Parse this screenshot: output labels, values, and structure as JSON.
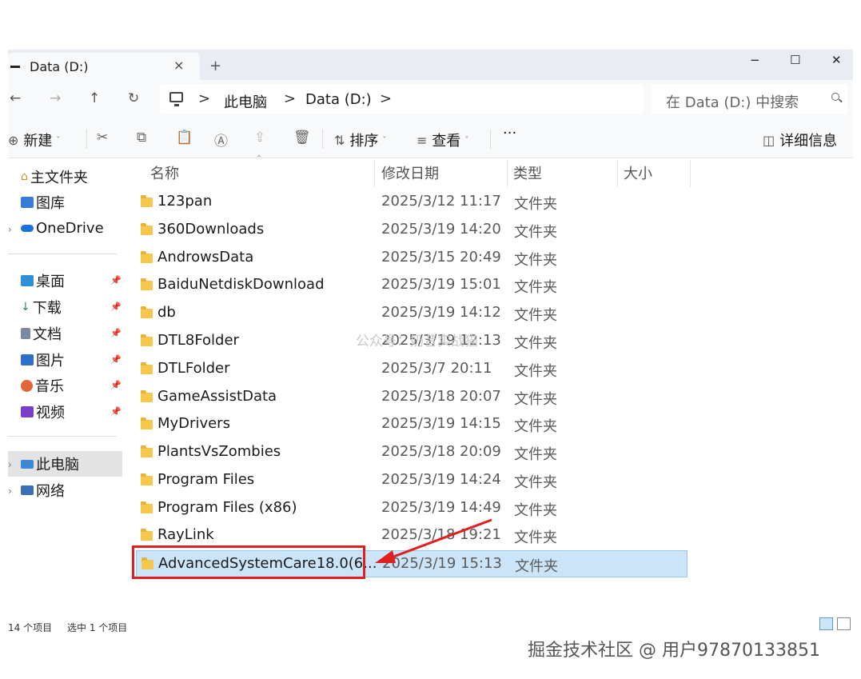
{
  "tab": {
    "title": "Data (D:)",
    "close": "×",
    "add": "+"
  },
  "window_controls": {
    "minimize": "−",
    "maximize": "☐",
    "close": "✕"
  },
  "nav": {
    "back": "←",
    "forward": "→",
    "up": "↑",
    "refresh": "↻"
  },
  "breadcrumb": {
    "sep1": ">",
    "item1": "此电脑",
    "sep2": ">",
    "item2": "Data (D:)",
    "sep3": ">"
  },
  "search": {
    "placeholder": "在 Data (D:) 中搜索"
  },
  "commands": {
    "new_label": "新建",
    "sort_label": "排序",
    "view_label": "查看",
    "more": "···",
    "details_label": "详细信息"
  },
  "sidebar": {
    "home": "主文件夹",
    "gallery": "图库",
    "onedrive": "OneDrive",
    "desktop": "桌面",
    "downloads": "下载",
    "documents": "文档",
    "pictures": "图片",
    "music": "音乐",
    "videos": "视频",
    "this_pc": "此电脑",
    "network": "网络"
  },
  "columns": {
    "name": "名称",
    "modified": "修改日期",
    "type": "类型",
    "size": "大小"
  },
  "files": [
    {
      "name": "123pan",
      "modified": "2025/3/12 11:17",
      "type": "文件夹"
    },
    {
      "name": "360Downloads",
      "modified": "2025/3/19 14:20",
      "type": "文件夹"
    },
    {
      "name": "AndrowsData",
      "modified": "2025/3/15 20:49",
      "type": "文件夹"
    },
    {
      "name": "BaiduNetdiskDownload",
      "modified": "2025/3/19 15:01",
      "type": "文件夹"
    },
    {
      "name": "db",
      "modified": "2025/3/19 14:12",
      "type": "文件夹"
    },
    {
      "name": "DTL8Folder",
      "modified": "2025/3/19 12:13",
      "type": "文件夹"
    },
    {
      "name": "DTLFolder",
      "modified": "2025/3/7 20:11",
      "type": "文件夹"
    },
    {
      "name": "GameAssistData",
      "modified": "2025/3/18 20:07",
      "type": "文件夹"
    },
    {
      "name": "MyDrivers",
      "modified": "2025/3/19 14:15",
      "type": "文件夹"
    },
    {
      "name": "PlantsVsZombies",
      "modified": "2025/3/18 20:09",
      "type": "文件夹"
    },
    {
      "name": "Program Files",
      "modified": "2025/3/19 14:24",
      "type": "文件夹"
    },
    {
      "name": "Program Files (x86)",
      "modified": "2025/3/19 14:49",
      "type": "文件夹"
    },
    {
      "name": "RayLink",
      "modified": "2025/3/18 19:21",
      "type": "文件夹"
    },
    {
      "name": "AdvancedSystemCare18.0(6...",
      "modified": "2025/3/19 15:13",
      "type": "文件夹"
    }
  ],
  "status": {
    "count": "14 个项目",
    "selected": "选中 1 个项目"
  },
  "watermark": "掘金技术社区 @ 用户97870133851",
  "overlay_text": "公众号：奶昔实战猫",
  "colors": {
    "selection": "#cce4f7",
    "highlight": "#e02020",
    "folder": "#f5c74a"
  }
}
